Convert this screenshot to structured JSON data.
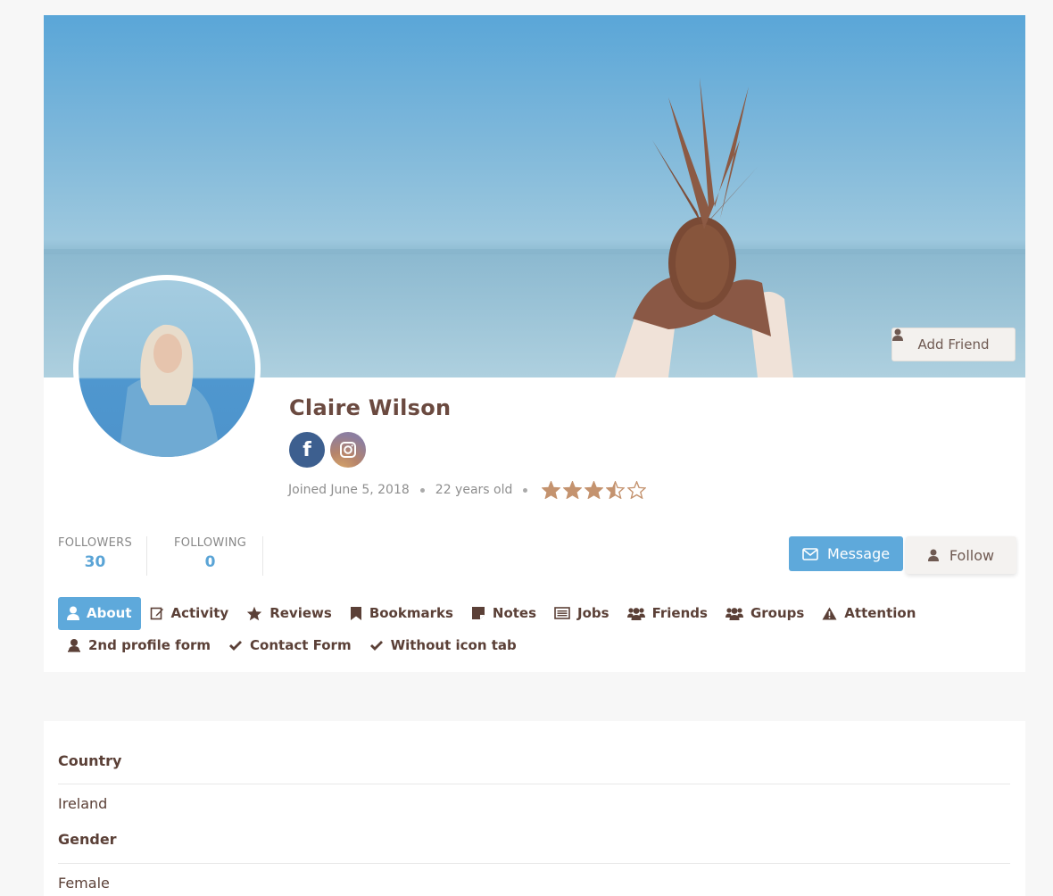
{
  "profile": {
    "name": "Claire Wilson",
    "joined": "Joined June 5, 2018",
    "age": "22 years old",
    "rating": 3.5,
    "rating_max": 5
  },
  "cover": {
    "add_friend_label": "Add Friend"
  },
  "social": [
    {
      "name": "facebook",
      "glyph": "f"
    },
    {
      "name": "instagram",
      "glyph": ""
    }
  ],
  "stats": {
    "followers_label": "FOLLOWERS",
    "followers_value": "30",
    "following_label": "FOLLOWING",
    "following_value": "0"
  },
  "actions": {
    "message_label": "Message",
    "follow_label": "Follow"
  },
  "tabs": [
    {
      "label": "About",
      "icon": "user-icon",
      "active": true
    },
    {
      "label": "Activity",
      "icon": "edit-icon"
    },
    {
      "label": "Reviews",
      "icon": "star-icon"
    },
    {
      "label": "Bookmarks",
      "icon": "bookmark-icon"
    },
    {
      "label": "Notes",
      "icon": "note-icon"
    },
    {
      "label": "Jobs",
      "icon": "list-alt-icon"
    },
    {
      "label": "Friends",
      "icon": "users-icon"
    },
    {
      "label": "Groups",
      "icon": "users-icon"
    },
    {
      "label": "Attention",
      "icon": "warning-icon"
    },
    {
      "label": "2nd profile form",
      "icon": "user-circle-icon"
    },
    {
      "label": "Contact Form",
      "icon": "check-icon"
    },
    {
      "label": "Without icon tab",
      "icon": "check-icon"
    }
  ],
  "details": {
    "country_label": "Country",
    "country_value": "Ireland",
    "gender_label": "Gender",
    "gender_value": "Female"
  },
  "colors": {
    "accent": "#5ea9db",
    "text": "#5b4037",
    "star": "#c4936f"
  }
}
